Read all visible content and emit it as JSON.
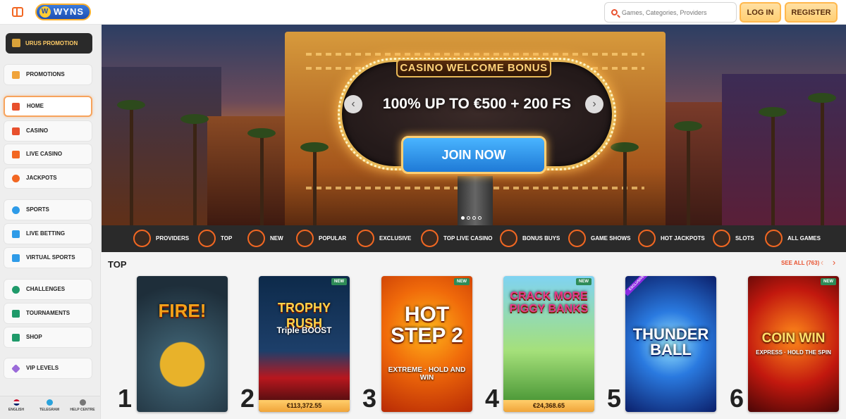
{
  "header": {
    "logo_text": "WYNS",
    "search_placeholder": "Games, Categories, Providers",
    "login_label": "LOG IN",
    "register_label": "REGISTER"
  },
  "sidebar": {
    "promo_banner": "URUS PROMOTION",
    "items": [
      {
        "label": "PROMOTIONS",
        "icon": "gift-icon"
      },
      {
        "label": "HOME",
        "icon": "home-icon"
      },
      {
        "label": "CASINO",
        "icon": "cards-icon"
      },
      {
        "label": "LIVE CASINO",
        "icon": "live-cards-icon"
      },
      {
        "label": "JACKPOTS",
        "icon": "clover-icon"
      },
      {
        "label": "SPORTS",
        "icon": "ball-icon"
      },
      {
        "label": "LIVE BETTING",
        "icon": "live-icon"
      },
      {
        "label": "VIRTUAL SPORTS",
        "icon": "virtual-icon"
      },
      {
        "label": "CHALLENGES",
        "icon": "medal-icon"
      },
      {
        "label": "TOURNAMENTS",
        "icon": "trophy-icon"
      },
      {
        "label": "SHOP",
        "icon": "shop-icon"
      },
      {
        "label": "VIP LEVELS",
        "icon": "diamond-icon"
      }
    ],
    "footer": {
      "language": "ENGLISH",
      "telegram": "TELEGRAM",
      "help": "HELP CENTRE"
    }
  },
  "hero": {
    "tag": "CASINO WELCOME BONUS",
    "offer": "100% UP TO €500 + 200 FS",
    "cta": "JOIN NOW",
    "slides": 4,
    "active_slide": 1
  },
  "categories": [
    "PROVIDERS",
    "TOP",
    "NEW",
    "POPULAR",
    "EXCLUSIVE",
    "TOP LIVE CASINO",
    "BONUS BUYS",
    "GAME SHOWS",
    "HOT JACKPOTS",
    "SLOTS",
    "ALL GAMES"
  ],
  "top_section": {
    "title": "TOP",
    "see_all": "SEE ALL (763)",
    "games": [
      {
        "rank": "1",
        "title": "FIRE!",
        "subtitle": "",
        "badge": "",
        "jackpot": ""
      },
      {
        "rank": "2",
        "title": "TROPHY RUSH",
        "subtitle": "Triple BOOST",
        "badge": "NEW",
        "jackpot": "€113,372.55"
      },
      {
        "rank": "3",
        "title": "HOT STEP 2",
        "subtitle": "EXTREME · HOLD AND WIN",
        "badge": "NEW",
        "jackpot": ""
      },
      {
        "rank": "4",
        "title": "CRACK MORE PIGGY BANKS",
        "subtitle": "",
        "badge": "NEW",
        "jackpot": "€24,368.65"
      },
      {
        "rank": "5",
        "title": "THUNDER BALL",
        "subtitle": "",
        "badge": "EXCLUSIVE",
        "jackpot": ""
      },
      {
        "rank": "6",
        "title": "COIN WIN",
        "subtitle": "EXPRESS · HOLD THE SPIN",
        "badge": "NEW",
        "jackpot": ""
      }
    ]
  },
  "colors": {
    "accent": "#f26722",
    "button_gold": "#ffcf73",
    "dark_bar": "#2a2a2a",
    "cta_blue": "#1f7ad6"
  }
}
